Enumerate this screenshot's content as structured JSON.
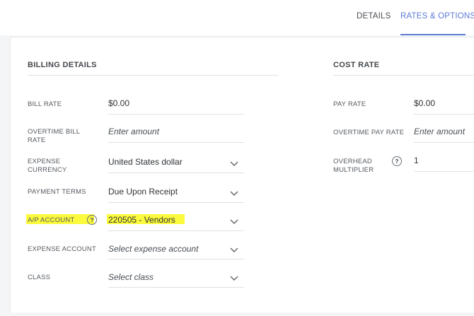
{
  "tabs": [
    {
      "label": "DETAILS",
      "active": false
    },
    {
      "label": "RATES & OPTIONS",
      "active": true
    }
  ],
  "billing": {
    "title": "BILLING DETAILS",
    "bill_rate_label": "BILL RATE",
    "bill_rate_value": "$0.00",
    "overtime_bill_label_1": "OVERTIME BILL",
    "overtime_bill_label_2": "RATE",
    "overtime_bill_placeholder": "Enter amount",
    "expense_currency_label_1": "EXPENSE",
    "expense_currency_label_2": "CURRENCY",
    "expense_currency_value": "United States dollar",
    "payment_terms_label": "PAYMENT TERMS",
    "payment_terms_value": "Due Upon Receipt",
    "ap_account_label": "A/P ACCOUNT",
    "ap_account_value": "220505 - Vendors",
    "expense_account_label": "EXPENSE ACCOUNT",
    "expense_account_placeholder": "Select expense account",
    "class_label": "CLASS",
    "class_placeholder": "Select class"
  },
  "cost": {
    "title": "COST RATE",
    "pay_rate_label": "PAY RATE",
    "pay_rate_value": "$0.00",
    "overtime_pay_label": "OVERTIME PAY RATE",
    "overtime_pay_placeholder": "Enter amount",
    "overhead_label_1": "OVERHEAD",
    "overhead_label_2": "MULTIPLIER",
    "overhead_value": "1"
  },
  "help_glyph": "?",
  "icons": [
    "chevron-down-icon",
    "help-circle-icon"
  ],
  "colors": {
    "accent": "#5b7bd5",
    "highlight": "#fbfa3c",
    "rule": "#dfe1e5"
  }
}
